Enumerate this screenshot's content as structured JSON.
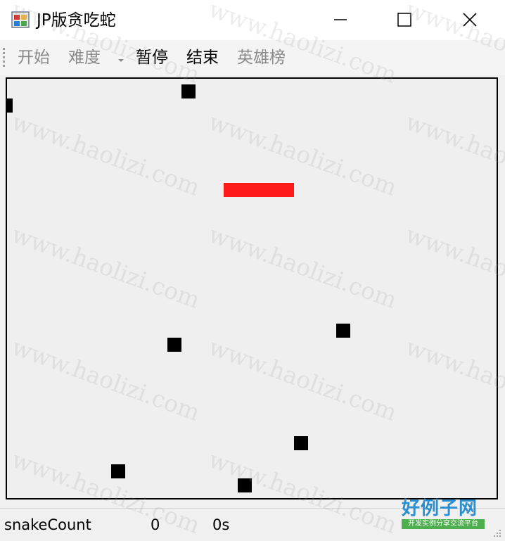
{
  "window": {
    "title": "JP版贪吃蛇",
    "icon": "snake-app-icon",
    "controls": [
      "minimize-icon",
      "maximize-icon",
      "close-icon"
    ]
  },
  "menu": {
    "items": [
      {
        "label": "开始",
        "enabled": false
      },
      {
        "label": "难度",
        "enabled": false,
        "dropdown": true
      },
      {
        "label": "暂停",
        "enabled": true
      },
      {
        "label": "结束",
        "enabled": true
      },
      {
        "label": "英雄榜",
        "enabled": false
      }
    ]
  },
  "game": {
    "grid_size": 20,
    "cols": 35,
    "rows": 30,
    "snake_color": "#ff1a1a",
    "food_color": "#000000",
    "snake_cells": [
      [
        15,
        7
      ],
      [
        16,
        7
      ],
      [
        17,
        7
      ],
      [
        18,
        7
      ],
      [
        19,
        7
      ]
    ],
    "food_cells": [
      [
        -1,
        1
      ],
      [
        12,
        0
      ],
      [
        11,
        18
      ],
      [
        23,
        17
      ],
      [
        20,
        25
      ],
      [
        7,
        27
      ],
      [
        16,
        28
      ]
    ]
  },
  "status": {
    "label": "snakeCount",
    "count": "0",
    "time": "0s"
  },
  "watermark": {
    "text": "www.haolizi.com",
    "logo_main": "好例子网",
    "logo_sub": "开发实例分享交流平台"
  }
}
